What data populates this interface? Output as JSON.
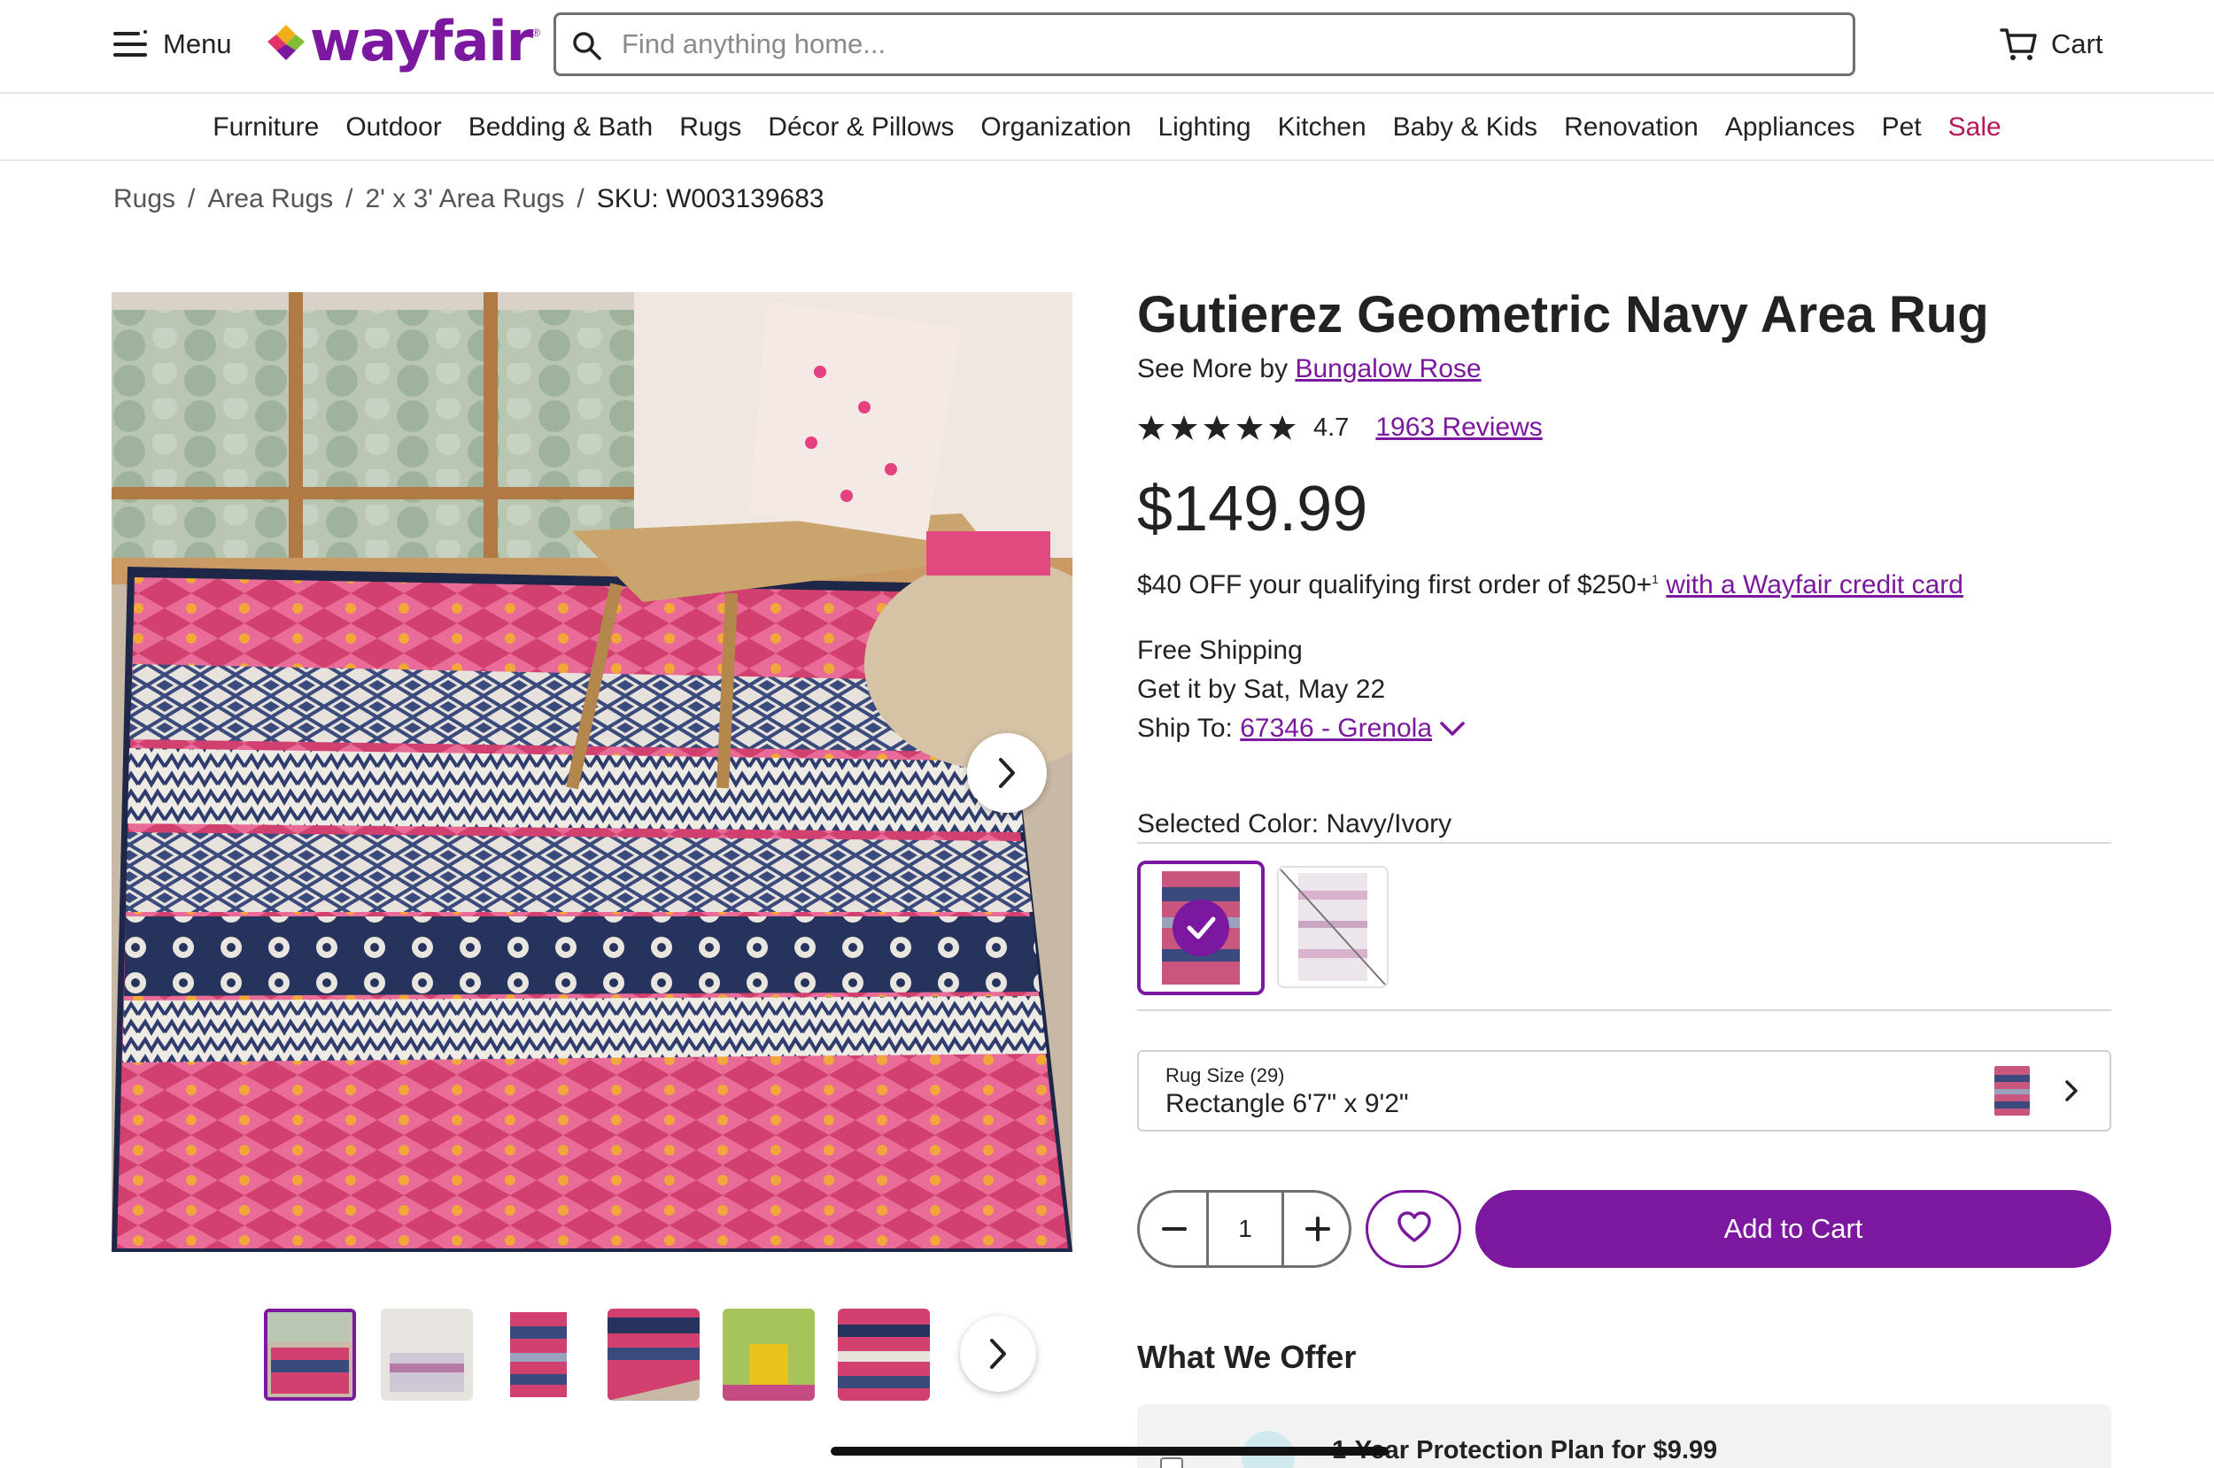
{
  "header": {
    "menu_label": "Menu",
    "logo_text": "wayfair",
    "search_placeholder": "Find anything home...",
    "cart_label": "Cart"
  },
  "nav": {
    "categories": [
      "Furniture",
      "Outdoor",
      "Bedding & Bath",
      "Rugs",
      "Décor & Pillows",
      "Organization",
      "Lighting",
      "Kitchen",
      "Baby & Kids",
      "Renovation",
      "Appliances",
      "Pet",
      "Sale"
    ]
  },
  "breadcrumb": {
    "items": [
      "Rugs",
      "Area Rugs",
      "2' x 3' Area Rugs"
    ],
    "sku": "SKU: W003139683",
    "separator": "/"
  },
  "product": {
    "title": "Gutierez Geometric Navy Area Rug",
    "see_more_prefix": "See More by",
    "brand": "Bungalow Rose",
    "rating": "4.7",
    "stars": 5,
    "reviews_label": "1963 Reviews",
    "price": "$149.99",
    "promo_text": "$40 OFF your qualifying first order of $250+",
    "promo_sup": "1",
    "promo_link": "with a Wayfair credit card",
    "shipping": "Free Shipping",
    "delivery": "Get it by Sat, May 22",
    "ship_to_label": "Ship To:",
    "ship_to_value": "67346 - Grenola",
    "selected_color_label": "Selected Color: Navy/Ivory",
    "size_label": "Rug Size (29)",
    "size_value": "Rectangle 6'7\" x 9'2\"",
    "quantity": "1",
    "add_to_cart": "Add to Cart"
  },
  "offers": {
    "title": "What We Offer",
    "plan": "1-Year Protection Plan for $9.99"
  },
  "colors": {
    "brand_purple": "#7b189f",
    "sale_red": "#b5195b"
  }
}
